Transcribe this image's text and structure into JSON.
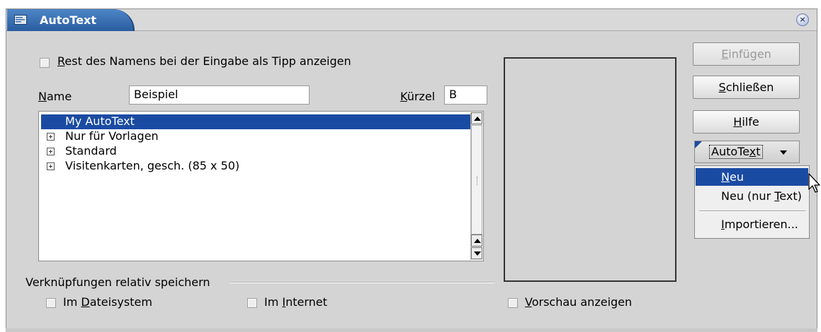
{
  "window": {
    "title": "AutoText",
    "close_symbol": "×"
  },
  "options": {
    "show_tip_label_prefix": "R",
    "show_tip_label_rest": "est des Namens bei der Eingabe als Tipp anzeigen",
    "show_tip_checked": false
  },
  "name_field": {
    "label_prefix": "N",
    "label_rest": "ame",
    "value": "Beispiel"
  },
  "shortcut_field": {
    "label_prefix": "K",
    "label_rest": "ürzel",
    "value": "B"
  },
  "tree": {
    "items": [
      {
        "label": "My AutoText",
        "selected": true,
        "expandable": false
      },
      {
        "label": "Nur für Vorlagen",
        "selected": false,
        "expandable": true
      },
      {
        "label": "Standard",
        "selected": false,
        "expandable": true
      },
      {
        "label": "Visitenkarten, gesch. (85 x 50)",
        "selected": false,
        "expandable": true
      }
    ]
  },
  "links": {
    "group_label": "Verknüpfungen relativ speichern",
    "filesystem_pre": "Im ",
    "filesystem_key": "D",
    "filesystem_rest": "ateisystem",
    "internet_pre": "Im ",
    "internet_key": "I",
    "internet_rest": "nternet"
  },
  "preview": {
    "key": "V",
    "rest": "orschau anzeigen"
  },
  "buttons": {
    "insert_key": "E",
    "insert_rest": "infügen",
    "close_key": "S",
    "close_rest": "chließen",
    "help_key": "H",
    "help_rest": "ilfe",
    "autotext_pre": "AutoTe",
    "autotext_key": "x",
    "autotext_rest": "t"
  },
  "menu": {
    "new_key": "N",
    "new_rest": "eu",
    "new_text_pre": "Neu (nur ",
    "new_text_key": "T",
    "new_text_rest": "ext)",
    "import_key": "I",
    "import_rest": "mportieren..."
  },
  "colors": {
    "selection": "#1a4ba3",
    "title_bar": "#3a70b5"
  }
}
